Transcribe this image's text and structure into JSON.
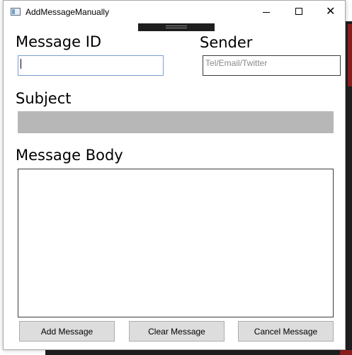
{
  "window": {
    "title": "AddMessageManually",
    "icon": "app-window-icon",
    "controls": {
      "minimize_icon": "minimize-icon",
      "maximize_icon": "maximize-icon",
      "close_icon": "close-icon",
      "close_glyph": "✕"
    }
  },
  "form": {
    "message_id": {
      "label": "Message ID",
      "value": ""
    },
    "sender": {
      "label": "Sender",
      "value": "",
      "placeholder": "Tel/Email/Twitter"
    },
    "subject": {
      "label": "Subject",
      "value": ""
    },
    "body": {
      "label": "Message Body",
      "value": ""
    }
  },
  "buttons": {
    "add": "Add Message",
    "clear": "Clear Message",
    "cancel": "Cancel Message"
  },
  "colors": {
    "subject_disabled_bg": "#b7b7b7",
    "focused_border": "#7a9fcf",
    "button_bg": "#dddddd"
  }
}
